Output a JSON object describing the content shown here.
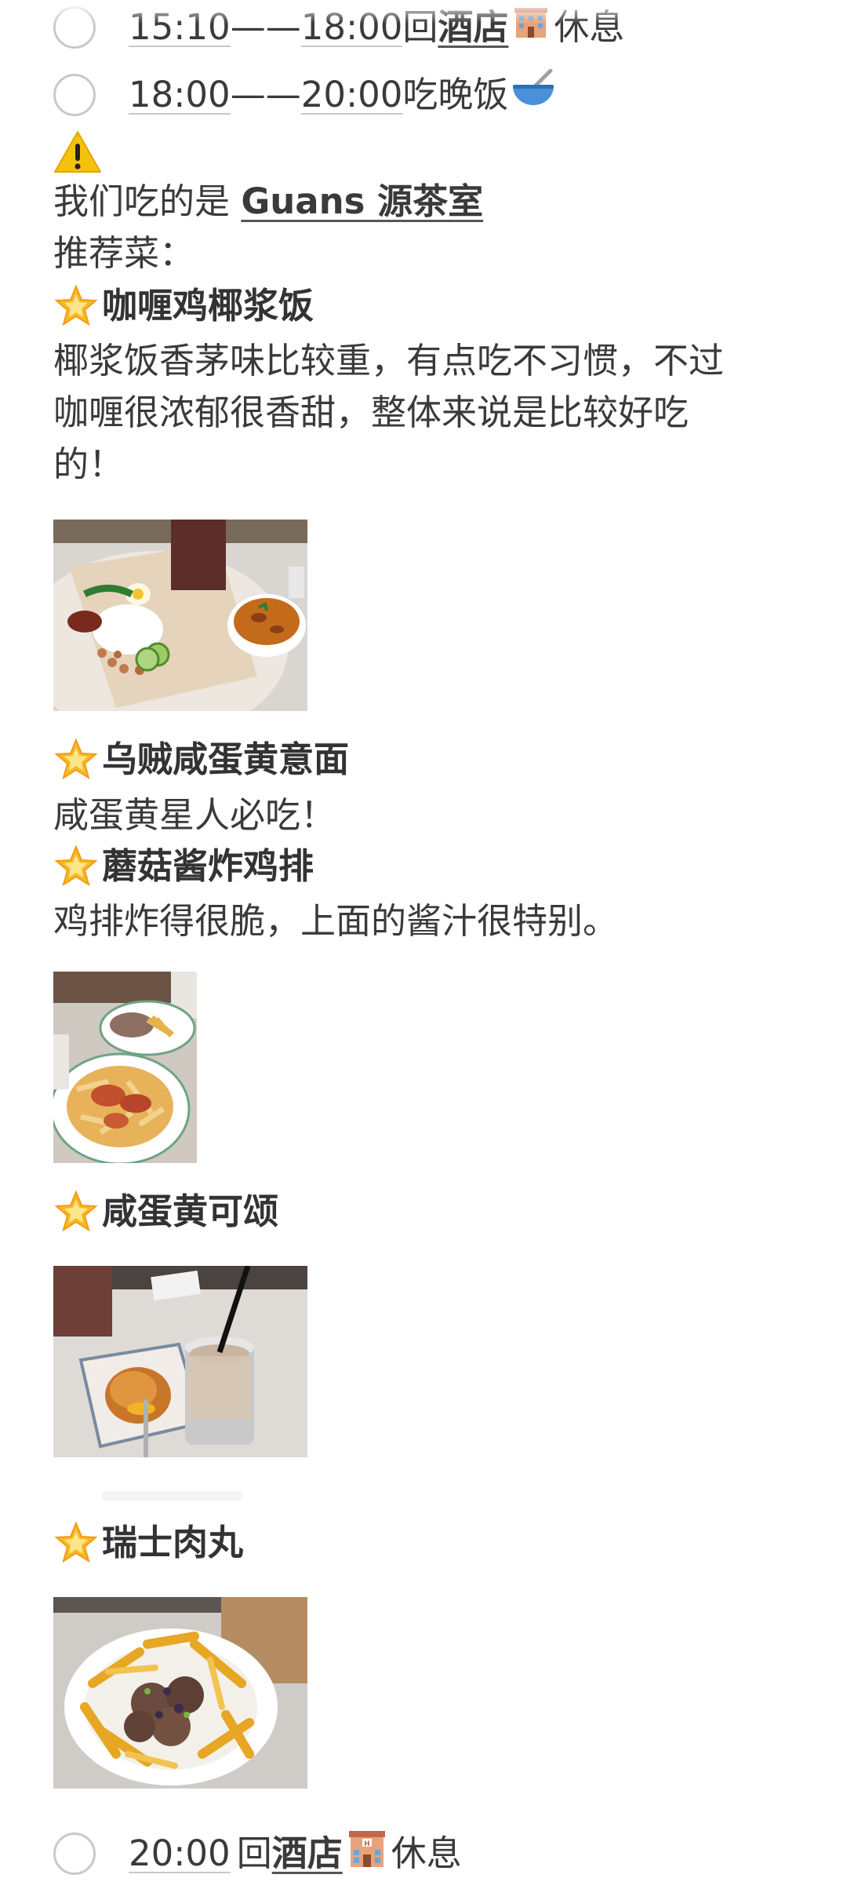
{
  "schedule": {
    "item_cut": {
      "start": "15:10",
      "dash": "——",
      "end": "18:00",
      "prefix": "回",
      "link": "酒店",
      "suffix": "休息"
    },
    "item_dinner": {
      "start": "18:00",
      "dash": "——",
      "end": "20:00",
      "text": "吃晚饭"
    },
    "item_last": {
      "time": "20:00",
      "prefix": "回",
      "link": "酒店",
      "suffix": "休息"
    }
  },
  "intro": {
    "prefix": "我们吃的是 ",
    "restaurant": "Guans 源茶室",
    "recommend_label": "推荐菜："
  },
  "dishes": [
    {
      "name": "咖喱鸡椰浆饭",
      "desc_lines": [
        "椰浆饭香茅味比较重，有点吃不习惯，不过",
        "咖喱很浓郁很香甜，整体来说是比较好吃",
        "的！"
      ]
    },
    {
      "name": "乌贼咸蛋黄意面",
      "desc_lines": [
        "咸蛋黄星人必吃！"
      ]
    },
    {
      "name": "蘑菇酱炸鸡排",
      "desc_lines": [
        "鸡排炸得很脆，上面的酱汁很特别。"
      ]
    },
    {
      "name": "咸蛋黄可颂",
      "desc_lines": []
    },
    {
      "name": "瑞士肉丸",
      "desc_lines": []
    }
  ],
  "icons": {
    "checkbox": "circle-checkbox-icon",
    "star": "glowing-star-icon",
    "warning": "warning-icon",
    "hotel": "hotel-icon",
    "bowl": "bowl-with-spoon-icon"
  },
  "colors": {
    "text": "#3a3a3a",
    "checkbox_border": "#c9c9c9",
    "star": "#f7b928",
    "warning": "#f4c20d"
  }
}
